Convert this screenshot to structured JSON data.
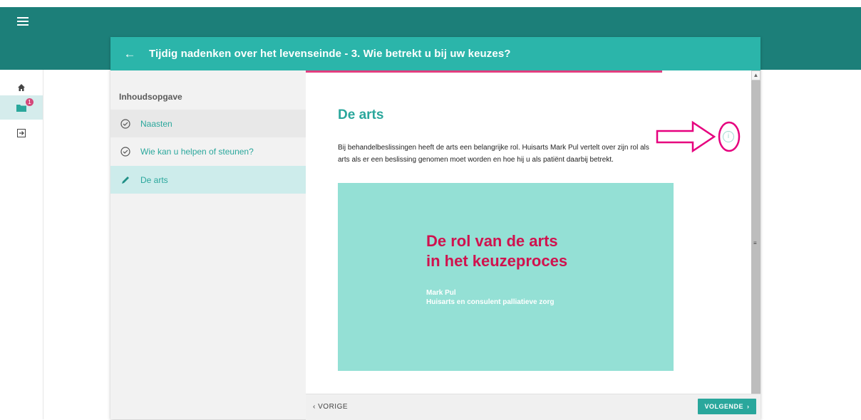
{
  "colors": {
    "topbar": "#1c7f79",
    "header": "#2bb5aa",
    "accent": "#2aa79c",
    "progress": "#e23d7f",
    "video_bg": "#94e0d5",
    "video_title": "#d0124e"
  },
  "nav": {
    "menu_icon": "hamburger-icon",
    "items": [
      {
        "icon": "home-icon"
      },
      {
        "icon": "folder-icon",
        "badge": "1"
      },
      {
        "icon": "logout-icon"
      }
    ]
  },
  "header": {
    "back_icon": "arrow-left-icon",
    "title": "Tijdig nadenken over het levenseinde - 3. Wie betrekt u bij uw keuzes?"
  },
  "toc": {
    "heading": "Inhoudsopgave",
    "items": [
      {
        "label": "Naasten",
        "icon": "check-circle-icon"
      },
      {
        "label": "Wie kan u helpen of steunen?",
        "icon": "check-circle-icon"
      },
      {
        "label": "De arts",
        "icon": "pencil-icon"
      }
    ]
  },
  "content": {
    "progress": 0.8,
    "heading": "De arts",
    "paragraph": "Bij behandelbeslissingen heeft de arts een belangrijke rol. Huisarts Mark Pul vertelt over zijn rol als arts als er een beslissing genomen moet worden en hoe hij u als patiënt daarbij betrekt.",
    "video": {
      "title_line1": "De rol van de arts",
      "title_line2": "in het keuzeproces",
      "speaker": "Mark Pul",
      "speaker_role": "Huisarts en consulent palliatieve zorg"
    },
    "info_icon": "info-icon"
  },
  "footer": {
    "prev_label": "VORIGE",
    "next_label": "VOLGENDE"
  }
}
